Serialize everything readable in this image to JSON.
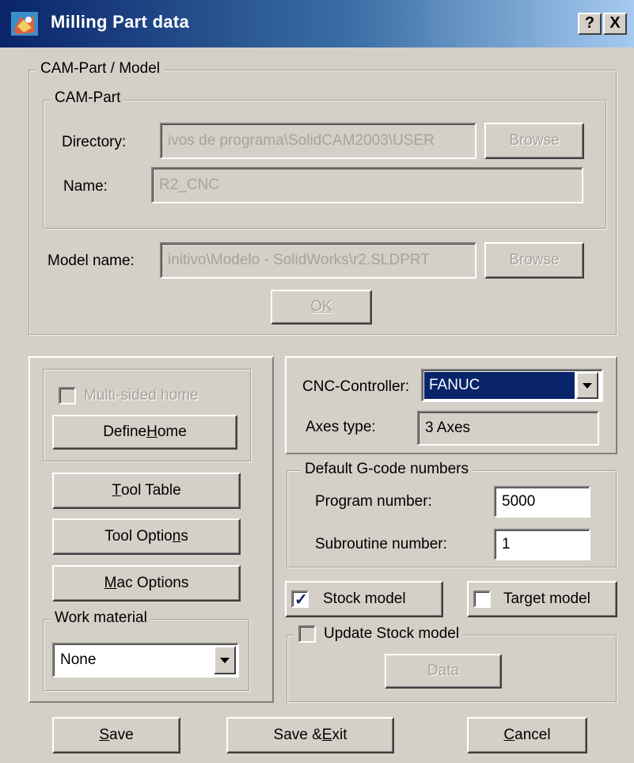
{
  "window": {
    "title": "Milling Part data",
    "help_btn": "?",
    "close_btn": "X"
  },
  "cam_model_group": {
    "legend": "CAM-Part / Model",
    "cam_part": {
      "legend": "CAM-Part",
      "directory_label": "Directory:",
      "directory_value": "ivos de programa\\SolidCAM2003\\USER",
      "browse_label": "Browse",
      "name_label": "Name:",
      "name_value": "R2_CNC"
    },
    "model_label": "Model name:",
    "model_value": "initivo\\Modelo - SolidWorks\\r2.SLDPRT",
    "browse_label": "Browse",
    "ok_label": "OK"
  },
  "left_panel": {
    "multi_sided_label": "Multi-sided home",
    "multi_sided_checked": false,
    "define_home": {
      "pre": "Define ",
      "key": "H",
      "post": "ome"
    },
    "tool_table": {
      "pre": "",
      "key": "T",
      "post": "ool Table"
    },
    "tool_options": {
      "pre": "Tool Optio",
      "key": "n",
      "post": "s"
    },
    "mac_options": {
      "pre": "",
      "key": "M",
      "post": "ac Options"
    },
    "work_material_legend": "Work material",
    "work_material_value": "None"
  },
  "right_panel": {
    "cnc_label": "CNC-Controller:",
    "cnc_value": "FANUC",
    "axes_label": "Axes type:",
    "axes_value": "3 Axes",
    "gcode": {
      "legend": "Default G-code numbers",
      "program_label": "Program number:",
      "program_value": "5000",
      "subroutine_label": "Subroutine number:",
      "subroutine_value": "1"
    },
    "stock_model_label": "Stock model",
    "stock_model_checked": true,
    "target_model_label": "Target model",
    "target_model_checked": false,
    "update_stock_label": "Update Stock model",
    "update_stock_checked": false,
    "data_label": "Data"
  },
  "footer": {
    "save": {
      "pre": "",
      "key": "S",
      "post": "ave"
    },
    "save_exit": {
      "pre": "Save & ",
      "key": "E",
      "post": "xit"
    },
    "cancel": {
      "pre": "",
      "key": "C",
      "post": "ancel"
    }
  },
  "colors": {
    "face": "#d4d0c8",
    "title_start": "#0a246a",
    "title_end": "#a6caf0",
    "selection": "#0a246a",
    "disabled_text": "#a7a39b"
  }
}
